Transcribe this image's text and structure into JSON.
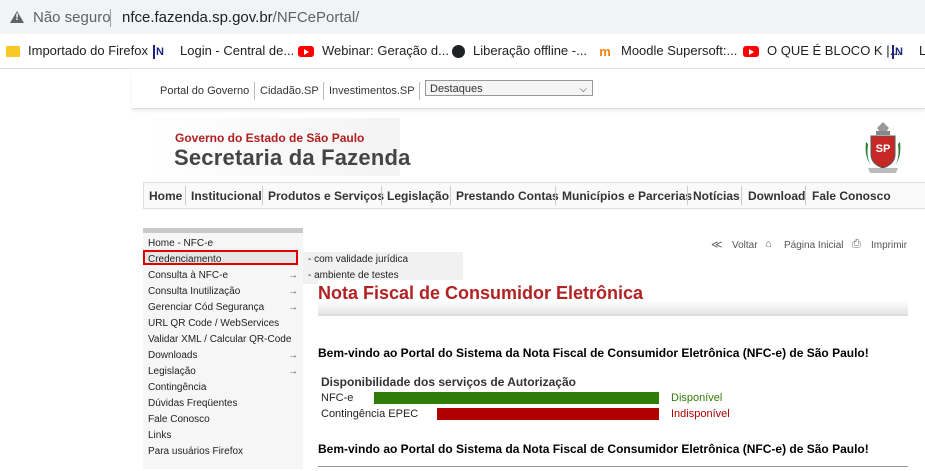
{
  "browser": {
    "security_label": "Não seguro",
    "url_domain": "nfce.fazenda.sp.gov.br",
    "url_path": "/NFCePortal/"
  },
  "bookmarks": [
    {
      "label": "Importado do Firefox",
      "icon": "folder-icon"
    },
    {
      "label": "Login - Central de...",
      "icon": "nfs-icon"
    },
    {
      "label": "Webinar: Geração d...",
      "icon": "youtube-icon"
    },
    {
      "label": "Liberação offline -...",
      "icon": "globe-icon"
    },
    {
      "label": "Moodle Supersoft:...",
      "icon": "moodle-icon"
    },
    {
      "label": "O QUE É BLOCO K |...",
      "icon": "youtube-icon"
    },
    {
      "label": "Lo",
      "icon": "nfs-icon"
    }
  ],
  "top_links": {
    "portal_governo": "Portal do Governo",
    "cidadao": "Cidadão.SP",
    "investimentos": "Investimentos.SP",
    "destaques": "Destaques"
  },
  "header": {
    "government": "Governo do Estado de São Paulo",
    "secretaria": "Secretaria da Fazenda",
    "seal_text": "SP"
  },
  "main_menu": [
    "Home",
    "Institucional",
    "Produtos e Serviços",
    "Legislação",
    "Prestando Contas",
    "Municípios e Parcerias",
    "Notícias",
    "Download",
    "Fale Conosco"
  ],
  "sidebar": [
    {
      "label": "Home - NFC-e",
      "arrow": false
    },
    {
      "label": "Credenciamento",
      "arrow": false
    },
    {
      "label": "Consulta à NFC-e",
      "arrow": true
    },
    {
      "label": "Consulta Inutilização",
      "arrow": true
    },
    {
      "label": "Gerenciar Cód Segurança",
      "arrow": true
    },
    {
      "label": "URL QR Code / WebServices",
      "arrow": false
    },
    {
      "label": "Validar XML / Calcular QR-Code",
      "arrow": false
    },
    {
      "label": "Downloads",
      "arrow": true
    },
    {
      "label": "Legislação",
      "arrow": true
    },
    {
      "label": "Contingência",
      "arrow": false
    },
    {
      "label": "Dúvidas Freqüentes",
      "arrow": false
    },
    {
      "label": "Fale Conosco",
      "arrow": false
    },
    {
      "label": "Links",
      "arrow": false
    },
    {
      "label": "Para usuários Firefox",
      "arrow": false
    }
  ],
  "submenu": [
    "- com validade jurídica",
    "- ambiente de testes"
  ],
  "utilities": {
    "voltar": "Voltar",
    "pagina_inicial": "Página Inicial",
    "imprimir": "Imprimir"
  },
  "content": {
    "title": "Nota Fiscal de Consumidor Eletrônica",
    "welcome": "Bem-vindo ao Portal do Sistema da Nota Fiscal de Consumidor Eletrônica (NFC-e) de São Paulo!",
    "availability_title": "Disponibilidade dos serviços de Autorização",
    "services": [
      {
        "name": "NFC-e",
        "status": "Disponível",
        "color": "#2e7d07"
      },
      {
        "name": "Contingência EPEC",
        "status": "Indisponível",
        "color": "#b00000"
      }
    ],
    "welcome_repeat": "Bem-vindo ao Portal do Sistema da Nota Fiscal de Consumidor Eletrônica (NFC-e) de São Paulo!"
  }
}
